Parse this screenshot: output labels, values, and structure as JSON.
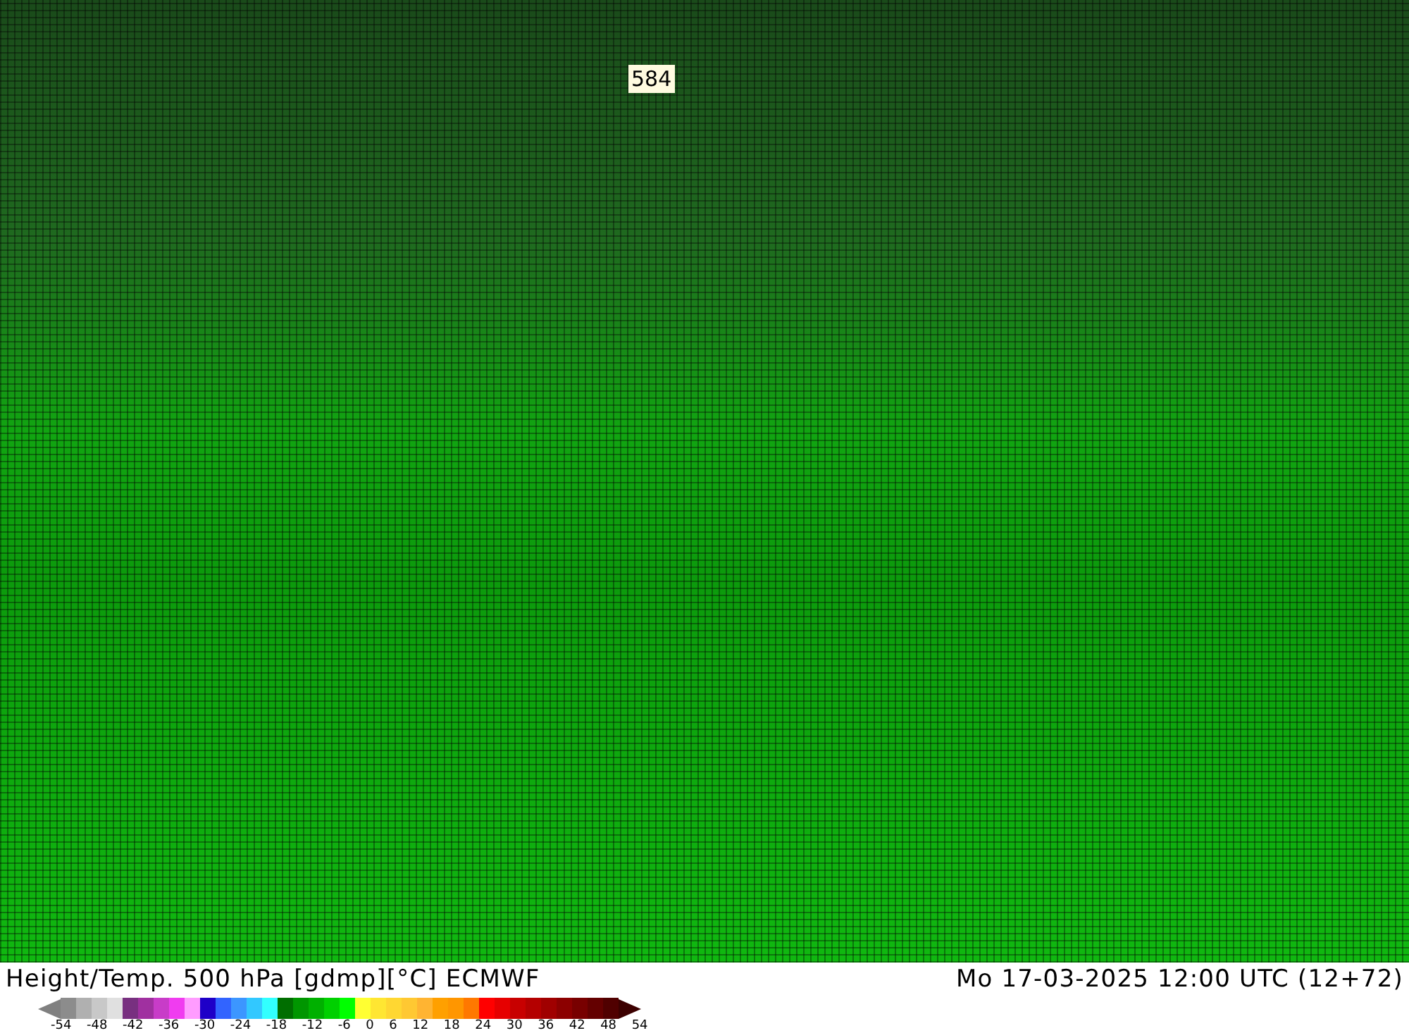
{
  "map": {
    "contour_label": "584"
  },
  "footer": {
    "title": "Height/Temp. 500 hPa [gdmp][°C] ECMWF",
    "valid_time": "Mo 17-03-2025 12:00 UTC (12+72)"
  },
  "legend": {
    "low_arrow": {
      "color": "#808080"
    },
    "high_arrow": {
      "color": "#3c0000"
    },
    "swatches": [
      {
        "color": "#8c8c8c"
      },
      {
        "color": "#b0b0b0"
      },
      {
        "color": "#c8c8c8"
      },
      {
        "color": "#e0e0e0"
      },
      {
        "color": "#783080"
      },
      {
        "color": "#a030a0"
      },
      {
        "color": "#c83cc8"
      },
      {
        "color": "#f03cf0"
      },
      {
        "color": "#ff9cff"
      },
      {
        "color": "#1e00c8"
      },
      {
        "color": "#3264ff"
      },
      {
        "color": "#3c96ff"
      },
      {
        "color": "#32c8ff"
      },
      {
        "color": "#32ffff"
      },
      {
        "color": "#006e00"
      },
      {
        "color": "#009600"
      },
      {
        "color": "#00b000"
      },
      {
        "color": "#00d000"
      },
      {
        "color": "#00ff00"
      },
      {
        "color": "#ffff32"
      },
      {
        "color": "#ffe632"
      },
      {
        "color": "#ffd732"
      },
      {
        "color": "#ffc832"
      },
      {
        "color": "#ffb432"
      },
      {
        "color": "#ffa000"
      },
      {
        "color": "#ff9600"
      },
      {
        "color": "#ff7800"
      },
      {
        "color": "#ff0000"
      },
      {
        "color": "#e60000"
      },
      {
        "color": "#c80000"
      },
      {
        "color": "#b40000"
      },
      {
        "color": "#a00000"
      },
      {
        "color": "#8c0000"
      },
      {
        "color": "#780000"
      },
      {
        "color": "#640000"
      },
      {
        "color": "#500000"
      }
    ],
    "ticks": [
      "-54",
      "-48",
      "-42",
      "-36",
      "-30",
      "-24",
      "-18",
      "-12",
      "-6",
      "0",
      "6",
      "12",
      "18",
      "24",
      "30",
      "36",
      "42",
      "48",
      "54"
    ]
  }
}
